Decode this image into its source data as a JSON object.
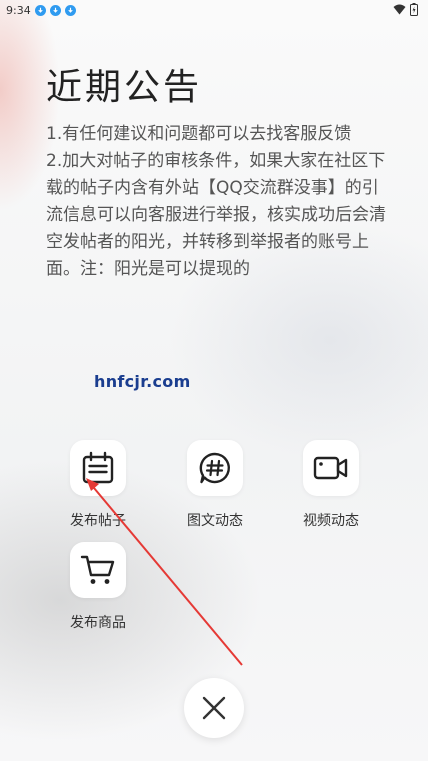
{
  "status_bar": {
    "time": "9:34",
    "icons": [
      "download-icon",
      "download-icon",
      "download-icon",
      "wifi-icon",
      "battery-icon"
    ]
  },
  "announcement": {
    "title": "近期公告",
    "body": "1.有任何建议和问题都可以去找客服反馈\n2.加大对帖子的审核条件，如果大家在社区下载的帖子内含有外站【QQ交流群没事】的引流信息可以向客服进行举报，核实成功后会清空发帖者的阳光，并转移到举报者的账号上面。注：阳光是可以提现的"
  },
  "watermark": "hnfcjr.com",
  "actions": [
    {
      "label": "发布帖子",
      "icon": "calendar-icon"
    },
    {
      "label": "图文动态",
      "icon": "hashtag-chat-icon"
    },
    {
      "label": "视频动态",
      "icon": "video-camera-icon"
    },
    {
      "label": "发布商品",
      "icon": "shopping-cart-icon"
    }
  ],
  "close": {
    "icon": "close-icon"
  },
  "colors": {
    "annotation_arrow": "#e53935",
    "watermark": "#1a3d8f",
    "download_badge": "#2f9bf0"
  }
}
